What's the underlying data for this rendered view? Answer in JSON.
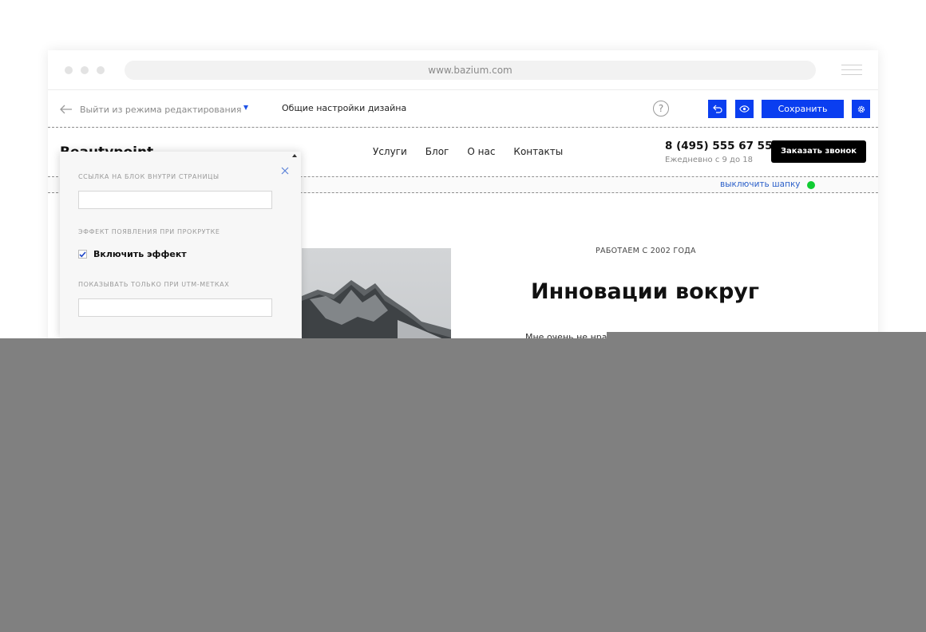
{
  "browser": {
    "url": "www.bazium.com"
  },
  "editor": {
    "exit_label": "Выйти из режима редактирования",
    "design_settings_label": "Общие настройки дизайна",
    "help_label": "?",
    "save_label": "Сохранить",
    "accent_color": "#0a3ef0"
  },
  "site": {
    "brand": "Beautypoint",
    "nav": [
      "Услуги",
      "Блог",
      "О нас",
      "Контакты"
    ],
    "phone": "8 (495) 555 67 55",
    "hours": "Ежедневно с 9 до 18",
    "call_button": "Заказать звонок",
    "header_toggle_link": "выключить шапку",
    "status_color": "#11cc33"
  },
  "hero": {
    "since": "РАБОТАЕМ С 2002 ГОДА",
    "title": "Инновации вокруг",
    "text": "Мне очень не нра"
  },
  "panel": {
    "anchor_label": "ССЫЛКА НА БЛОК ВНУТРИ СТРАНИЦЫ",
    "anchor_value": "",
    "scroll_effect_label": "ЭФФЕКТ ПОЯВЛЕНИЯ ПРИ ПРОКРУТКЕ",
    "enable_effect_label": "Включить эффект",
    "enable_effect_checked": true,
    "utm_label": "ПОКАЗЫВАТЬ ТОЛЬКО ПРИ UTM-МЕТКАХ",
    "utm_value": ""
  }
}
